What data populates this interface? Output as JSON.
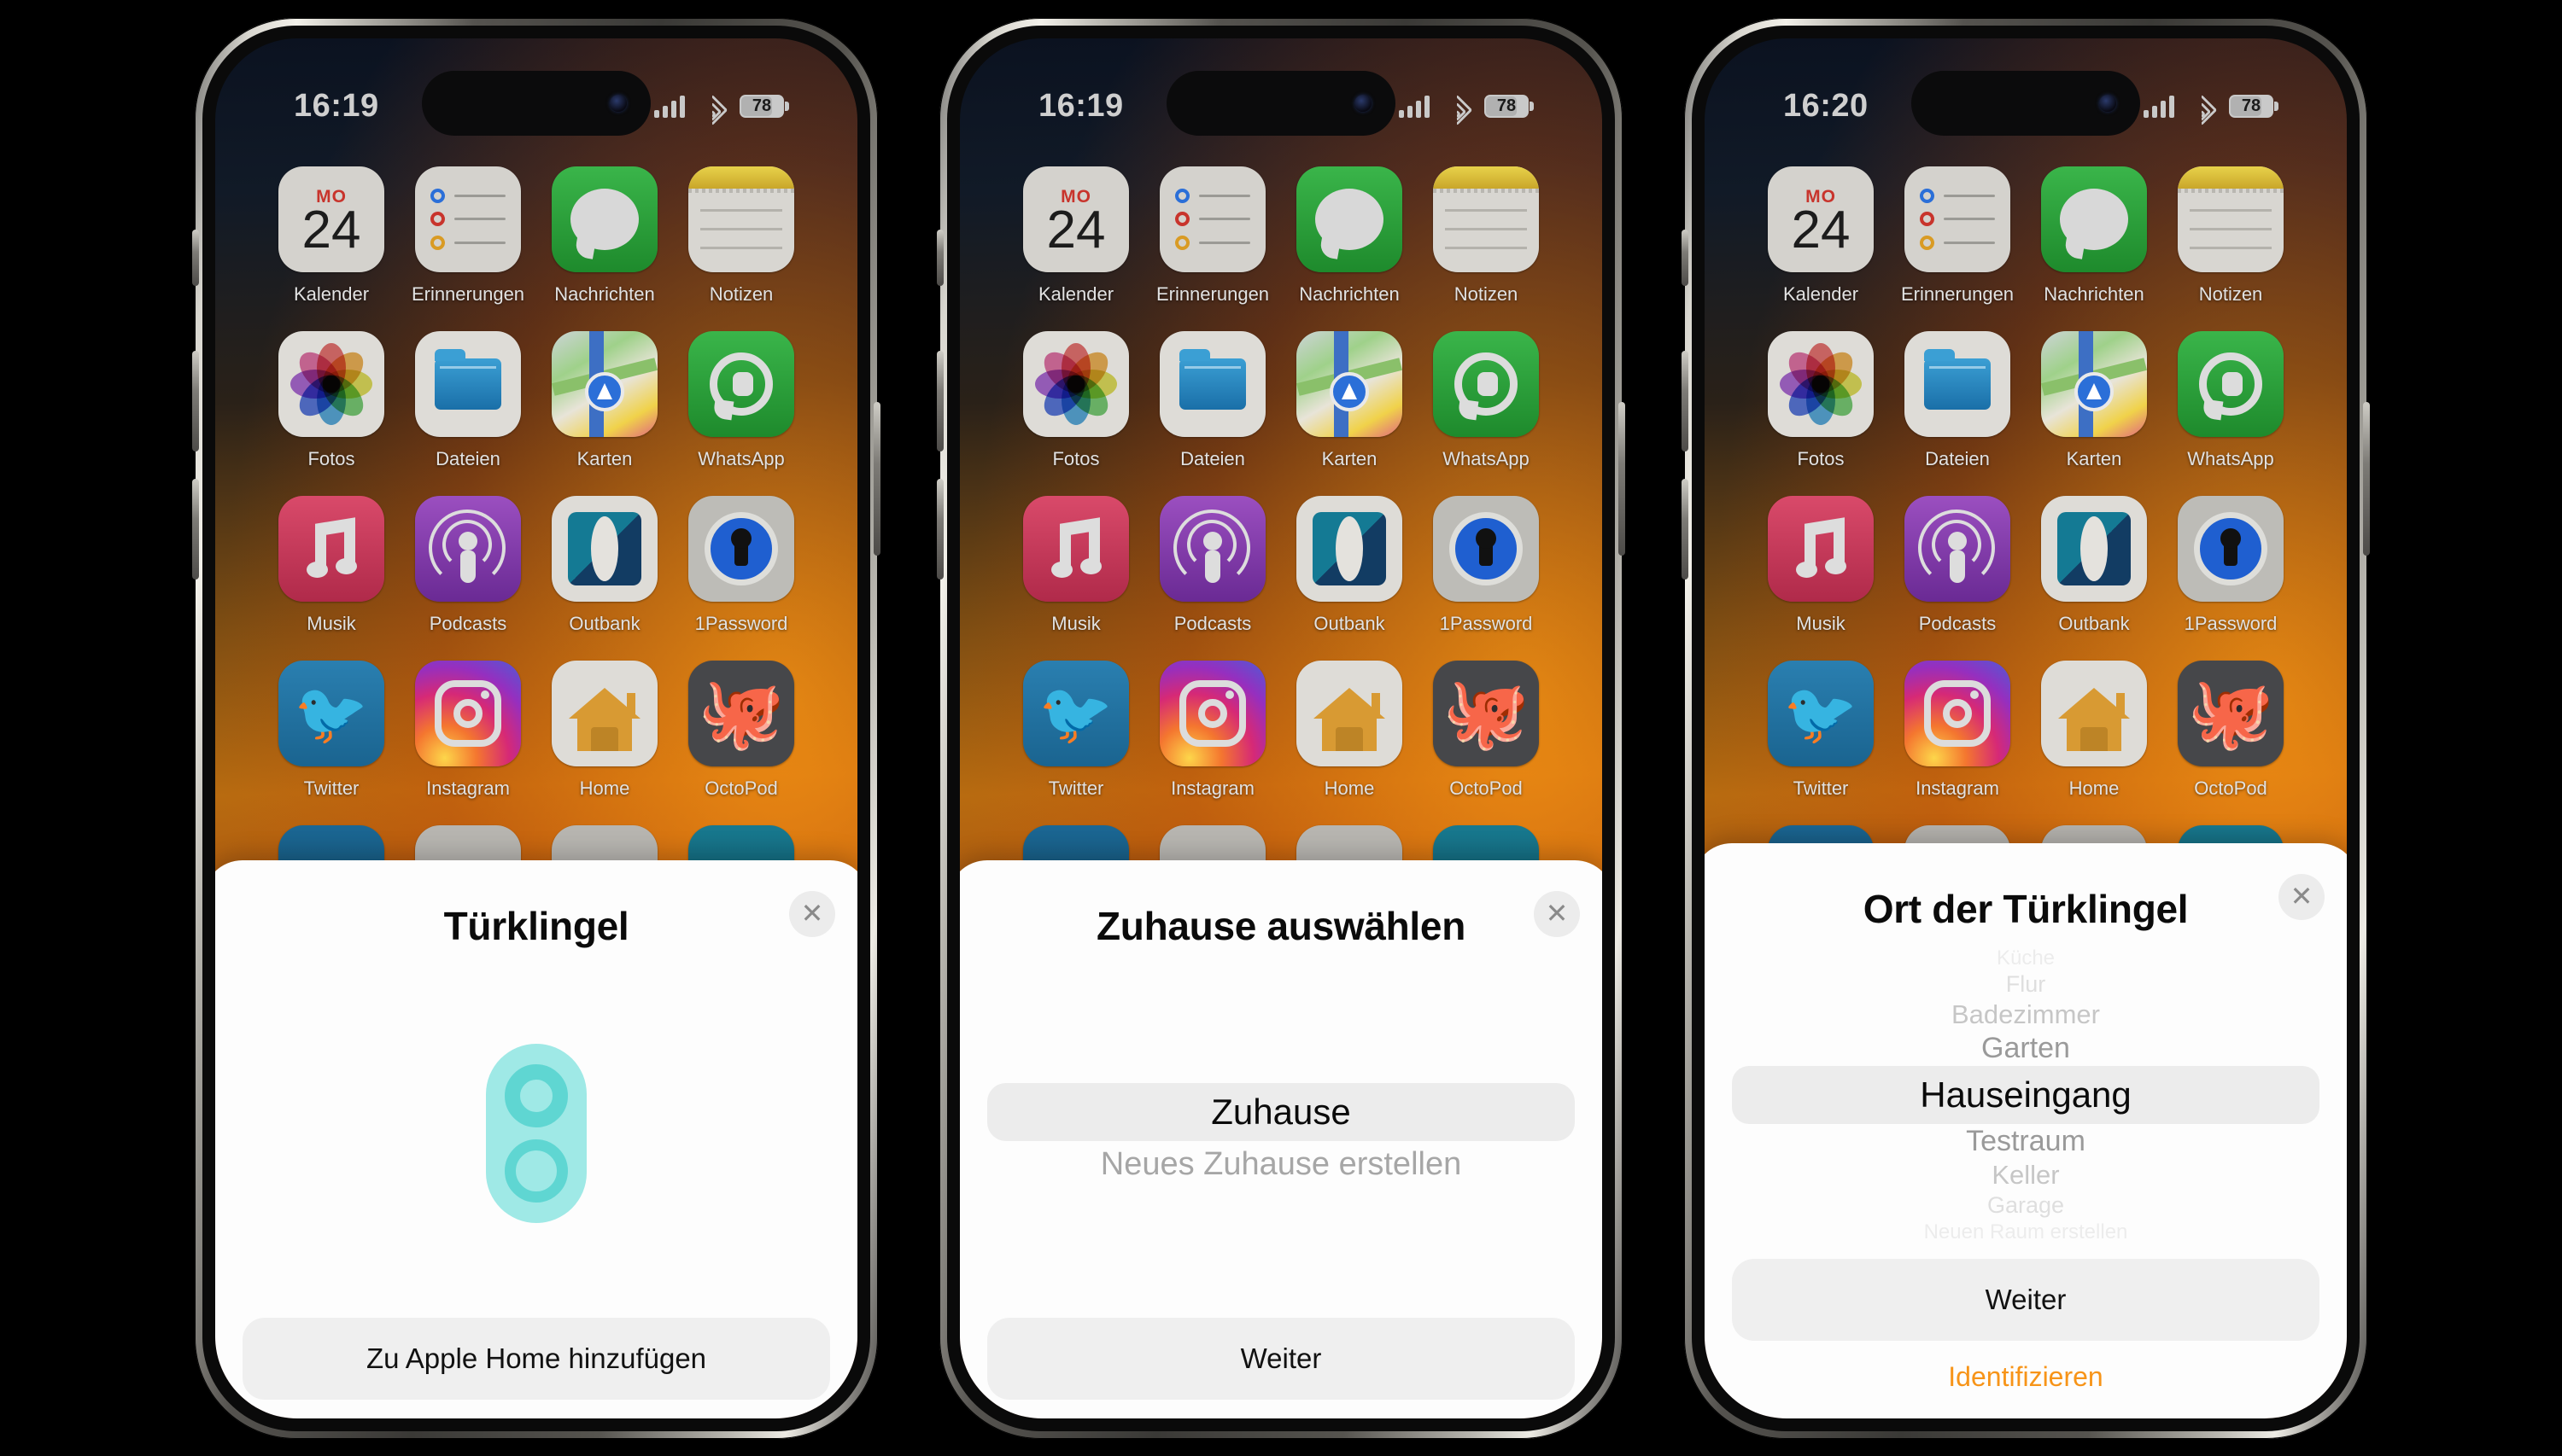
{
  "status_bars": [
    {
      "time": "16:19",
      "battery": "78",
      "signal_icon": "cellular-signal-icon",
      "wifi_icon": "wifi-icon",
      "battery_icon": "battery-icon"
    },
    {
      "time": "16:19",
      "battery": "78",
      "signal_icon": "cellular-signal-icon",
      "wifi_icon": "wifi-icon",
      "battery_icon": "battery-icon"
    },
    {
      "time": "16:20",
      "battery": "78",
      "signal_icon": "cellular-signal-icon",
      "wifi_icon": "wifi-icon",
      "battery_icon": "battery-icon"
    }
  ],
  "homescreen": {
    "calendar_weekday": "MO",
    "calendar_day": "24",
    "apps": [
      {
        "label": "Kalender",
        "icon": "calendar-icon"
      },
      {
        "label": "Erinnerungen",
        "icon": "reminders-icon"
      },
      {
        "label": "Nachrichten",
        "icon": "messages-icon"
      },
      {
        "label": "Notizen",
        "icon": "notes-icon"
      },
      {
        "label": "Fotos",
        "icon": "photos-icon"
      },
      {
        "label": "Dateien",
        "icon": "files-icon"
      },
      {
        "label": "Karten",
        "icon": "maps-icon"
      },
      {
        "label": "WhatsApp",
        "icon": "whatsapp-icon"
      },
      {
        "label": "Musik",
        "icon": "music-icon"
      },
      {
        "label": "Podcasts",
        "icon": "podcasts-icon"
      },
      {
        "label": "Outbank",
        "icon": "outbank-icon"
      },
      {
        "label": "1Password",
        "icon": "1password-icon"
      },
      {
        "label": "Twitter",
        "icon": "twitter-icon"
      },
      {
        "label": "Instagram",
        "icon": "instagram-icon"
      },
      {
        "label": "Home",
        "icon": "home-icon"
      },
      {
        "label": "OctoPod",
        "icon": "octopod-icon"
      }
    ]
  },
  "sheet1": {
    "title": "Türklingel",
    "close_icon": "close-icon",
    "device_icon": "doorbell-icon",
    "primary_button": "Zu Apple Home hinzufügen"
  },
  "sheet2": {
    "title": "Zuhause auswählen",
    "close_icon": "close-icon",
    "selected_home": "Zuhause",
    "create_home_option": "Neues Zuhause erstellen",
    "primary_button": "Weiter"
  },
  "sheet3": {
    "title": "Ort der Türklingel",
    "close_icon": "close-icon",
    "rooms": [
      "Küche",
      "Flur",
      "Badezimmer",
      "Garten",
      "Hauseingang",
      "Testraum",
      "Keller",
      "Garage",
      "Neuen Raum erstellen"
    ],
    "selected_room": "Hauseingang",
    "primary_button": "Weiter",
    "secondary_link": "Identifizieren"
  },
  "colors": {
    "accent_orange": "#f79418",
    "doorbell_teal": "#9fe9e6",
    "doorbell_ring": "#5fd6d2",
    "sheet_bg": "#fdfdfd",
    "pill_bg": "#efefef"
  }
}
